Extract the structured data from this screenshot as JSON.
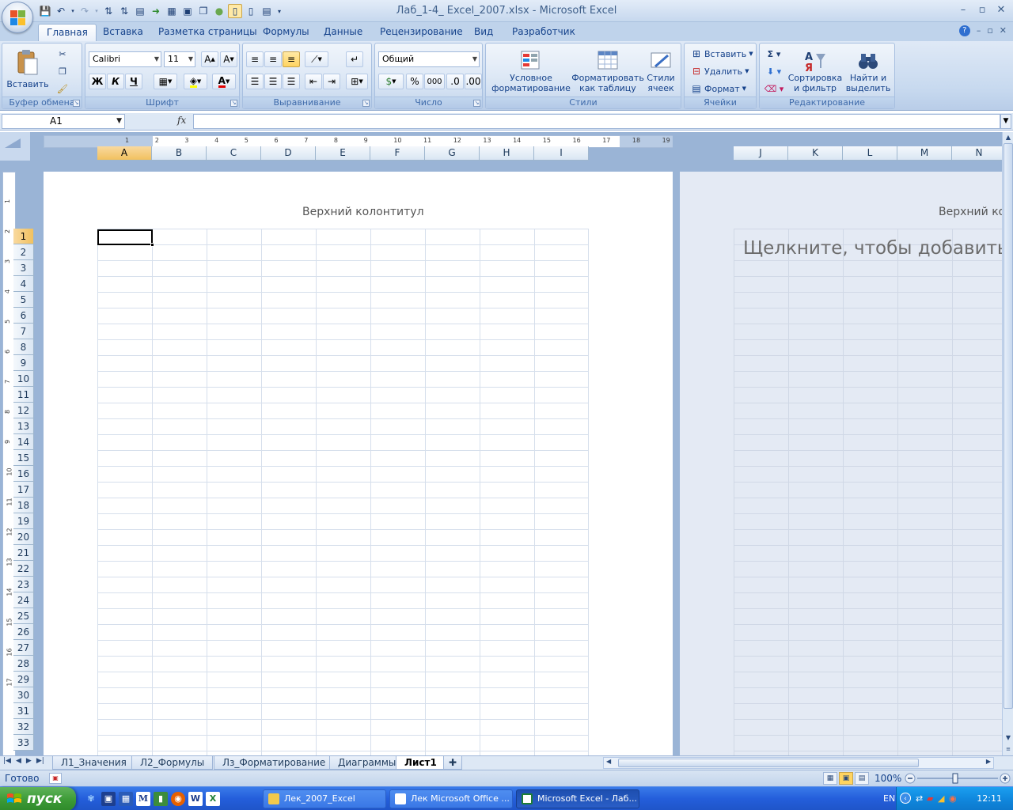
{
  "window": {
    "title": "Лаб_1-4_ Excel_2007.xlsx - Microsoft Excel",
    "controls": [
      "–",
      "▫",
      "✕"
    ]
  },
  "tabs": [
    "Главная",
    "Вставка",
    "Разметка страницы",
    "Формулы",
    "Данные",
    "Рецензирование",
    "Вид",
    "Разработчик"
  ],
  "active_tab": "Главная",
  "ribbon": {
    "clipboard": {
      "title": "Буфер обмена",
      "paste": "Вставить"
    },
    "font": {
      "title": "Шрифт",
      "font_name": "Calibri",
      "font_size": "11",
      "bold": "Ж",
      "italic": "К",
      "underline": "Ч"
    },
    "alignment": {
      "title": "Выравнивание"
    },
    "number": {
      "title": "Число",
      "format": "Общий",
      "percent": "%",
      "thousands": "000"
    },
    "styles": {
      "title": "Стили",
      "conditional_1": "Условное",
      "conditional_2": "форматирование",
      "as_table_1": "Форматировать",
      "as_table_2": "как таблицу",
      "cell_styles_1": "Стили",
      "cell_styles_2": "ячеек"
    },
    "cells": {
      "title": "Ячейки",
      "insert": "Вставить",
      "delete": "Удалить",
      "format": "Формат"
    },
    "editing": {
      "title": "Редактирование",
      "sort_1": "Сортировка",
      "sort_2": "и фильтр",
      "find_1": "Найти и",
      "find_2": "выделить"
    }
  },
  "formula_bar": {
    "name_box": "A1",
    "fx": "fx",
    "value": ""
  },
  "sheet": {
    "columns_left": [
      "A",
      "B",
      "C",
      "D",
      "E",
      "F",
      "G",
      "H",
      "I"
    ],
    "columns_right": [
      "J",
      "K",
      "L",
      "M",
      "N"
    ],
    "rows": [
      "1",
      "2",
      "3",
      "4",
      "5",
      "6",
      "7",
      "8",
      "9",
      "10",
      "11",
      "12",
      "13",
      "14",
      "15",
      "16",
      "17",
      "18",
      "19",
      "20",
      "21",
      "22",
      "23",
      "24",
      "25",
      "26",
      "27",
      "28",
      "29",
      "30",
      "31",
      "32",
      "33"
    ],
    "ruler_ticks": [
      "1",
      "2",
      "3",
      "4",
      "5",
      "6",
      "7",
      "8",
      "9",
      "10",
      "11",
      "12",
      "13",
      "14",
      "15",
      "16",
      "17",
      "18",
      "19"
    ],
    "vruler_ticks": [
      "1",
      "2",
      "3",
      "4",
      "5",
      "6",
      "7",
      "8",
      "9",
      "10",
      "11",
      "12",
      "13",
      "14",
      "15",
      "16",
      "17"
    ],
    "header_left": "Верхний колонтитул",
    "header_right": "Верхний ко",
    "click_to_add": "Щелкните, чтобы добавить д",
    "selected_cell": "A1"
  },
  "sheet_tabs": [
    "Л1_Значения",
    "Л2_Формулы",
    "Лз_Форматирование",
    "Диаграммы",
    "Лист1"
  ],
  "active_sheet": "Лист1",
  "status": {
    "text": "Готово",
    "zoom": "100%"
  },
  "taskbar": {
    "start": "пуск",
    "tasks": [
      "Лек_2007_Excel",
      "Лек Microsoft Office ...",
      "Microsoft Excel - Лаб..."
    ],
    "active_task": "Microsoft Excel - Лаб...",
    "lang": "EN",
    "clock": "12:11"
  },
  "colors": {
    "accent": "#15428b",
    "ribbon_bg": "#c7d9ef",
    "selection": "#f1c15f",
    "taskbar": "#245edb",
    "start": "#3c9a36"
  }
}
